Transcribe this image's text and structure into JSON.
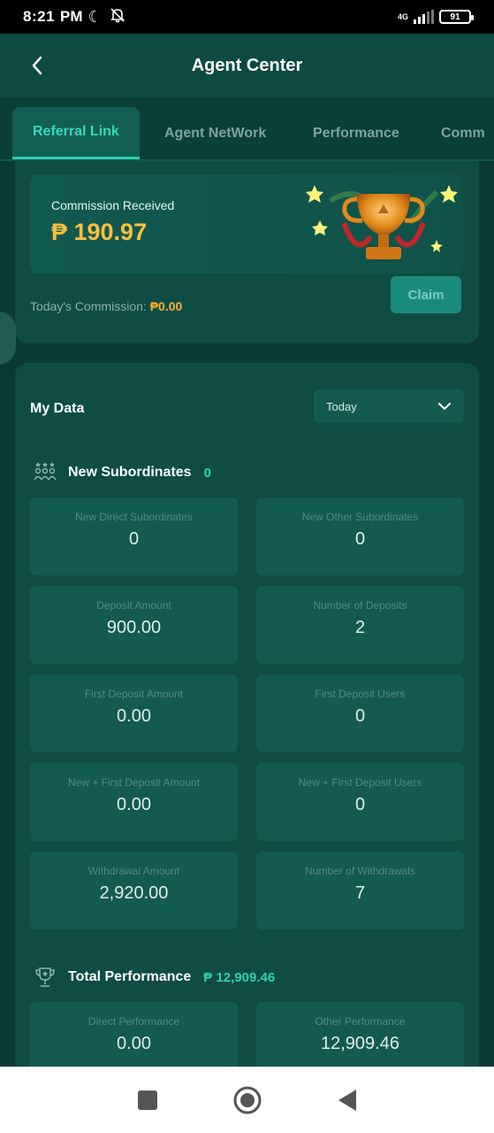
{
  "status_bar": {
    "time": "8:21",
    "ampm": "PM",
    "network": "4G",
    "battery": "91"
  },
  "header": {
    "title": "Agent Center"
  },
  "tabs": [
    {
      "label": "Referral Link",
      "active": true
    },
    {
      "label": "Agent NetWork",
      "active": false
    },
    {
      "label": "Performance",
      "active": false
    },
    {
      "label": "Comm",
      "active": false
    }
  ],
  "commission": {
    "label": "Commission Received",
    "value": "₱ 190.97",
    "today_label": "Today's Commission:",
    "today_value": "₱0.00",
    "claim_label": "Claim"
  },
  "my_data": {
    "title": "My Data",
    "period": "Today",
    "new_subordinates": {
      "label": "New Subordinates",
      "count": "0"
    },
    "stats": [
      {
        "label": "New Direct Subordinates",
        "value": "0"
      },
      {
        "label": "New Other Subordinates",
        "value": "0"
      },
      {
        "label": "Deposit Amount",
        "value": "900.00"
      },
      {
        "label": "Number of Deposits",
        "value": "2"
      },
      {
        "label": "First Deposit Amount",
        "value": "0.00"
      },
      {
        "label": "First Deposit Users",
        "value": "0"
      },
      {
        "label": "New + First Deposit Amount",
        "value": "0.00"
      },
      {
        "label": "New + First Deposit Users",
        "value": "0"
      },
      {
        "label": "Withdrawal Amount",
        "value": "2,920.00"
      },
      {
        "label": "Number of Withdrawals",
        "value": "7"
      }
    ],
    "total_performance": {
      "label": "Total Performance",
      "value": "₱ 12,909.46"
    },
    "perf_stats": [
      {
        "label": "Direct Performance",
        "value": "0.00"
      },
      {
        "label": "Other Performance",
        "value": "12,909.46"
      }
    ]
  },
  "icons": {
    "back": "chevron-left-icon",
    "moon": "moon-icon",
    "bell": "bell-off-icon",
    "subordinates": "people-group-icon",
    "trophy": "trophy-icon",
    "dropdown": "chevron-down-icon"
  },
  "colors": {
    "accent": "#2fcfb0",
    "commission": "#ffbf3d",
    "background": "#0a3a33"
  }
}
